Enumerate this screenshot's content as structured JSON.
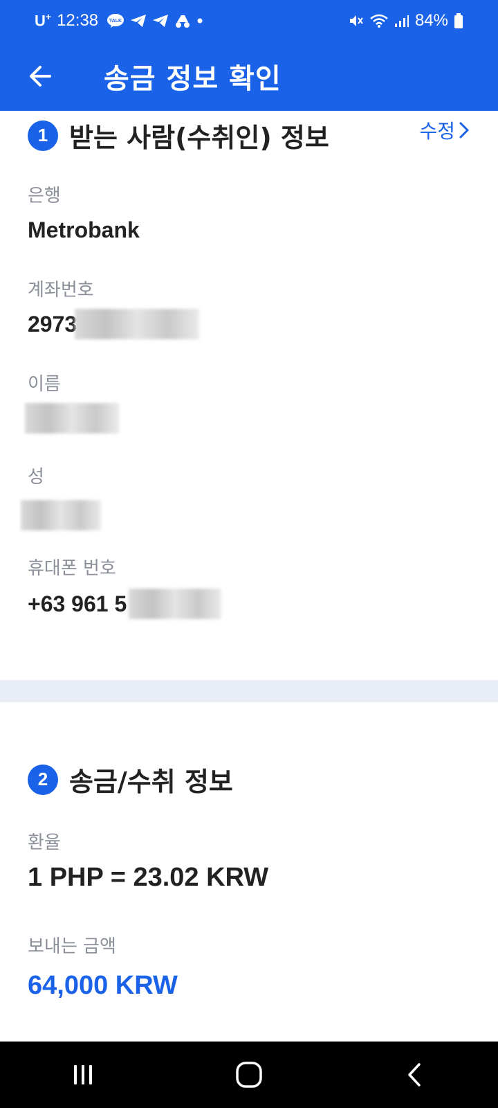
{
  "status_bar": {
    "carrier": "U",
    "carrier_sup": "+",
    "time": "12:38",
    "talk_icon_text": "TALK",
    "battery": "84%"
  },
  "app_bar": {
    "title": "송금 정보 확인"
  },
  "recipient_section": {
    "step": "1",
    "title": "받는 사람(수취인) 정보",
    "edit_label": "수정",
    "fields": [
      {
        "label": "은행",
        "value": "Metrobank"
      },
      {
        "label": "계좌번호",
        "value": "2973"
      },
      {
        "label": "이름",
        "value": ""
      },
      {
        "label": "성",
        "value": ""
      },
      {
        "label": "휴대폰 번호",
        "value": "+63 961 5"
      }
    ]
  },
  "transfer_section": {
    "step": "2",
    "title": "송금/수취 정보",
    "rate_label": "환율",
    "rate_value": "1 PHP = 23.02 KRW",
    "amount_label": "보내는 금액",
    "amount_value": "64,000 KRW"
  },
  "colors": {
    "accent": "#1a63e8",
    "label_gray": "#8a8f99",
    "divider": "#e8edf6"
  },
  "icons": {
    "back": "arrow-left-icon",
    "edit_chevron": "chevron-right-icon",
    "nav_recents": "recents-icon",
    "nav_home": "home-icon",
    "nav_back": "nav-back-icon"
  }
}
